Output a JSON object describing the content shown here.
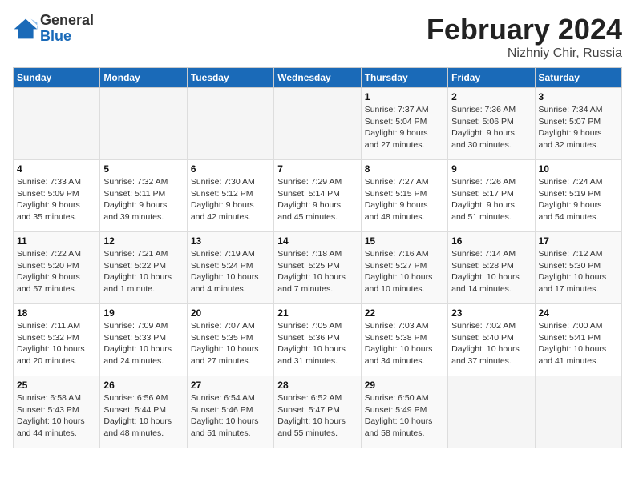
{
  "header": {
    "logo_general": "General",
    "logo_blue": "Blue",
    "month_title": "February 2024",
    "location": "Nizhniy Chir, Russia"
  },
  "weekdays": [
    "Sunday",
    "Monday",
    "Tuesday",
    "Wednesday",
    "Thursday",
    "Friday",
    "Saturday"
  ],
  "weeks": [
    [
      {
        "day": "",
        "info": ""
      },
      {
        "day": "",
        "info": ""
      },
      {
        "day": "",
        "info": ""
      },
      {
        "day": "",
        "info": ""
      },
      {
        "day": "1",
        "info": "Sunrise: 7:37 AM\nSunset: 5:04 PM\nDaylight: 9 hours\nand 27 minutes."
      },
      {
        "day": "2",
        "info": "Sunrise: 7:36 AM\nSunset: 5:06 PM\nDaylight: 9 hours\nand 30 minutes."
      },
      {
        "day": "3",
        "info": "Sunrise: 7:34 AM\nSunset: 5:07 PM\nDaylight: 9 hours\nand 32 minutes."
      }
    ],
    [
      {
        "day": "4",
        "info": "Sunrise: 7:33 AM\nSunset: 5:09 PM\nDaylight: 9 hours\nand 35 minutes."
      },
      {
        "day": "5",
        "info": "Sunrise: 7:32 AM\nSunset: 5:11 PM\nDaylight: 9 hours\nand 39 minutes."
      },
      {
        "day": "6",
        "info": "Sunrise: 7:30 AM\nSunset: 5:12 PM\nDaylight: 9 hours\nand 42 minutes."
      },
      {
        "day": "7",
        "info": "Sunrise: 7:29 AM\nSunset: 5:14 PM\nDaylight: 9 hours\nand 45 minutes."
      },
      {
        "day": "8",
        "info": "Sunrise: 7:27 AM\nSunset: 5:15 PM\nDaylight: 9 hours\nand 48 minutes."
      },
      {
        "day": "9",
        "info": "Sunrise: 7:26 AM\nSunset: 5:17 PM\nDaylight: 9 hours\nand 51 minutes."
      },
      {
        "day": "10",
        "info": "Sunrise: 7:24 AM\nSunset: 5:19 PM\nDaylight: 9 hours\nand 54 minutes."
      }
    ],
    [
      {
        "day": "11",
        "info": "Sunrise: 7:22 AM\nSunset: 5:20 PM\nDaylight: 9 hours\nand 57 minutes."
      },
      {
        "day": "12",
        "info": "Sunrise: 7:21 AM\nSunset: 5:22 PM\nDaylight: 10 hours\nand 1 minute."
      },
      {
        "day": "13",
        "info": "Sunrise: 7:19 AM\nSunset: 5:24 PM\nDaylight: 10 hours\nand 4 minutes."
      },
      {
        "day": "14",
        "info": "Sunrise: 7:18 AM\nSunset: 5:25 PM\nDaylight: 10 hours\nand 7 minutes."
      },
      {
        "day": "15",
        "info": "Sunrise: 7:16 AM\nSunset: 5:27 PM\nDaylight: 10 hours\nand 10 minutes."
      },
      {
        "day": "16",
        "info": "Sunrise: 7:14 AM\nSunset: 5:28 PM\nDaylight: 10 hours\nand 14 minutes."
      },
      {
        "day": "17",
        "info": "Sunrise: 7:12 AM\nSunset: 5:30 PM\nDaylight: 10 hours\nand 17 minutes."
      }
    ],
    [
      {
        "day": "18",
        "info": "Sunrise: 7:11 AM\nSunset: 5:32 PM\nDaylight: 10 hours\nand 20 minutes."
      },
      {
        "day": "19",
        "info": "Sunrise: 7:09 AM\nSunset: 5:33 PM\nDaylight: 10 hours\nand 24 minutes."
      },
      {
        "day": "20",
        "info": "Sunrise: 7:07 AM\nSunset: 5:35 PM\nDaylight: 10 hours\nand 27 minutes."
      },
      {
        "day": "21",
        "info": "Sunrise: 7:05 AM\nSunset: 5:36 PM\nDaylight: 10 hours\nand 31 minutes."
      },
      {
        "day": "22",
        "info": "Sunrise: 7:03 AM\nSunset: 5:38 PM\nDaylight: 10 hours\nand 34 minutes."
      },
      {
        "day": "23",
        "info": "Sunrise: 7:02 AM\nSunset: 5:40 PM\nDaylight: 10 hours\nand 37 minutes."
      },
      {
        "day": "24",
        "info": "Sunrise: 7:00 AM\nSunset: 5:41 PM\nDaylight: 10 hours\nand 41 minutes."
      }
    ],
    [
      {
        "day": "25",
        "info": "Sunrise: 6:58 AM\nSunset: 5:43 PM\nDaylight: 10 hours\nand 44 minutes."
      },
      {
        "day": "26",
        "info": "Sunrise: 6:56 AM\nSunset: 5:44 PM\nDaylight: 10 hours\nand 48 minutes."
      },
      {
        "day": "27",
        "info": "Sunrise: 6:54 AM\nSunset: 5:46 PM\nDaylight: 10 hours\nand 51 minutes."
      },
      {
        "day": "28",
        "info": "Sunrise: 6:52 AM\nSunset: 5:47 PM\nDaylight: 10 hours\nand 55 minutes."
      },
      {
        "day": "29",
        "info": "Sunrise: 6:50 AM\nSunset: 5:49 PM\nDaylight: 10 hours\nand 58 minutes."
      },
      {
        "day": "",
        "info": ""
      },
      {
        "day": "",
        "info": ""
      }
    ]
  ]
}
